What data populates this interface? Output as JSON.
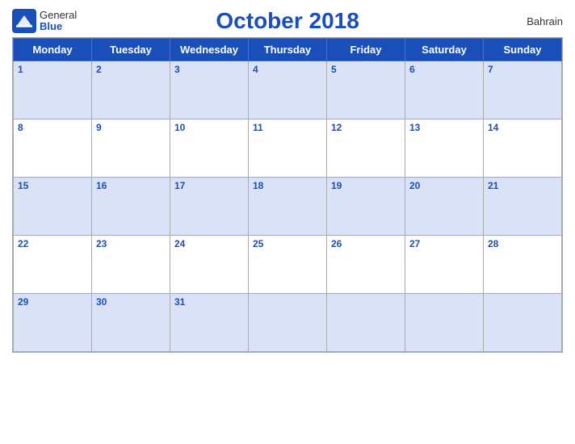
{
  "header": {
    "logo_general": "General",
    "logo_blue": "Blue",
    "title": "October 2018",
    "country": "Bahrain"
  },
  "weekdays": [
    "Monday",
    "Tuesday",
    "Wednesday",
    "Thursday",
    "Friday",
    "Saturday",
    "Sunday"
  ],
  "weeks": [
    [
      1,
      2,
      3,
      4,
      5,
      6,
      7
    ],
    [
      8,
      9,
      10,
      11,
      12,
      13,
      14
    ],
    [
      15,
      16,
      17,
      18,
      19,
      20,
      21
    ],
    [
      22,
      23,
      24,
      25,
      26,
      27,
      28
    ],
    [
      29,
      30,
      31,
      null,
      null,
      null,
      null
    ]
  ]
}
